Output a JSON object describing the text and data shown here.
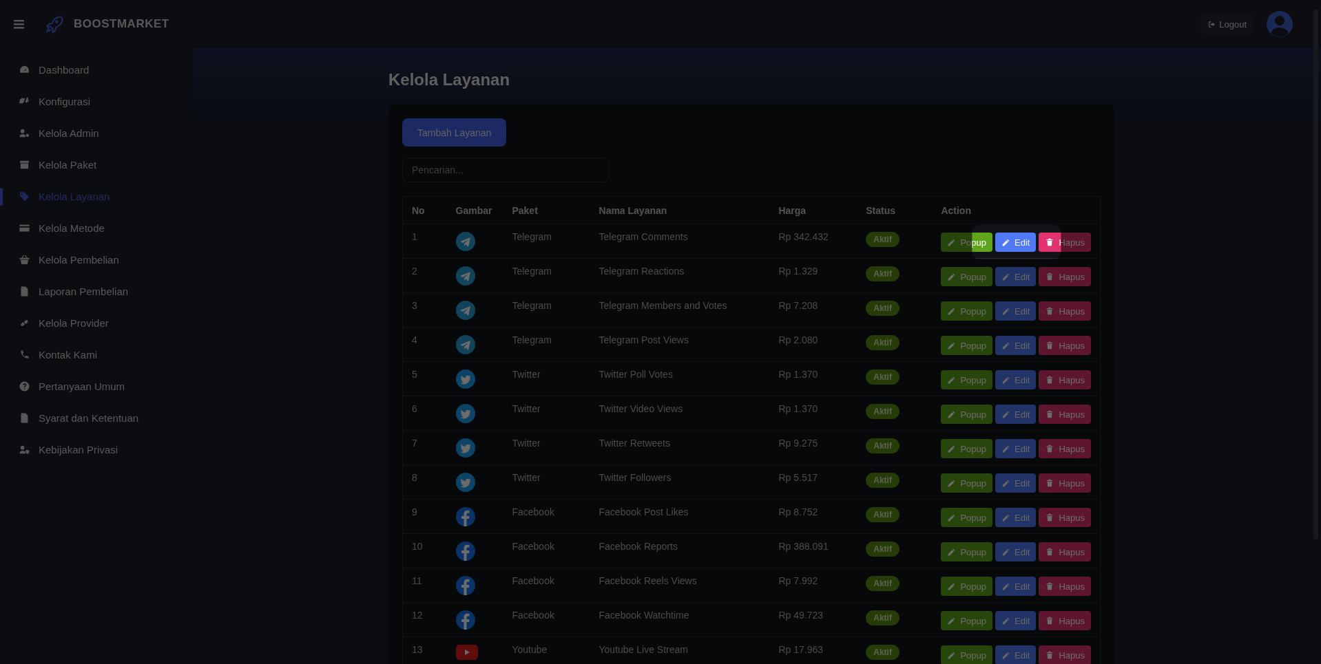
{
  "brand": {
    "name": "BOOSTMARKET"
  },
  "header": {
    "logout": "Logout"
  },
  "sidebar": {
    "items": [
      {
        "label": "Dashboard",
        "selected": false
      },
      {
        "label": "Konfigurasi",
        "selected": false
      },
      {
        "label": "Kelola Admin",
        "selected": false
      },
      {
        "label": "Kelola Paket",
        "selected": false
      },
      {
        "label": "Kelola Layanan",
        "selected": true
      },
      {
        "label": "Kelola Metode",
        "selected": false
      },
      {
        "label": "Kelola Pembelian",
        "selected": false
      },
      {
        "label": "Laporan Pembelian",
        "selected": false
      },
      {
        "label": "Kelola Provider",
        "selected": false
      },
      {
        "label": "Kontak Kami",
        "selected": false
      },
      {
        "label": "Pertanyaan Umum",
        "selected": false
      },
      {
        "label": "Syarat dan Ketentuan",
        "selected": false
      },
      {
        "label": "Kebijakan Privasi",
        "selected": false
      }
    ]
  },
  "page": {
    "title": "Kelola Layanan",
    "add_button": "Tambah Layanan",
    "search": {
      "placeholder": "Pencarian..."
    }
  },
  "table": {
    "columns": [
      "No",
      "Gambar",
      "Paket",
      "Nama Layanan",
      "Harga",
      "Status",
      "Action"
    ],
    "rows": [
      {
        "no": "1",
        "kind": "telegram",
        "paket": "Telegram",
        "name": "Telegram Comments",
        "price": "Rp 342.432",
        "status": "Aktif",
        "popup": "Popup",
        "edit": "Edit",
        "delete": "Hapus",
        "highlighted": true
      },
      {
        "no": "2",
        "kind": "telegram",
        "paket": "Telegram",
        "name": "Telegram Reactions",
        "price": "Rp 1.329",
        "status": "Aktif",
        "popup": "Popup",
        "edit": "Edit",
        "delete": "Hapus",
        "highlighted": false
      },
      {
        "no": "3",
        "kind": "telegram",
        "paket": "Telegram",
        "name": "Telegram Members and Votes",
        "price": "Rp 7.208",
        "status": "Aktif",
        "popup": "Popup",
        "edit": "Edit",
        "delete": "Hapus",
        "highlighted": false
      },
      {
        "no": "4",
        "kind": "telegram",
        "paket": "Telegram",
        "name": "Telegram Post Views",
        "price": "Rp 2.080",
        "status": "Aktif",
        "popup": "Popup",
        "edit": "Edit",
        "delete": "Hapus",
        "highlighted": false
      },
      {
        "no": "5",
        "kind": "twitter",
        "paket": "Twitter",
        "name": "Twitter Poll Votes",
        "price": "Rp 1.370",
        "status": "Aktif",
        "popup": "Popup",
        "edit": "Edit",
        "delete": "Hapus",
        "highlighted": false
      },
      {
        "no": "6",
        "kind": "twitter",
        "paket": "Twitter",
        "name": "Twitter Video Views",
        "price": "Rp 1.370",
        "status": "Aktif",
        "popup": "Popup",
        "edit": "Edit",
        "delete": "Hapus",
        "highlighted": false
      },
      {
        "no": "7",
        "kind": "twitter",
        "paket": "Twitter",
        "name": "Twitter Retweets",
        "price": "Rp 9.275",
        "status": "Aktif",
        "popup": "Popup",
        "edit": "Edit",
        "delete": "Hapus",
        "highlighted": false
      },
      {
        "no": "8",
        "kind": "twitter",
        "paket": "Twitter",
        "name": "Twitter Followers",
        "price": "Rp 5.517",
        "status": "Aktif",
        "popup": "Popup",
        "edit": "Edit",
        "delete": "Hapus",
        "highlighted": false
      },
      {
        "no": "9",
        "kind": "facebook",
        "paket": "Facebook",
        "name": "Facebook Post Likes",
        "price": "Rp 8.752",
        "status": "Aktif",
        "popup": "Popup",
        "edit": "Edit",
        "delete": "Hapus",
        "highlighted": false
      },
      {
        "no": "10",
        "kind": "facebook",
        "paket": "Facebook",
        "name": "Facebook Reports",
        "price": "Rp 388.091",
        "status": "Aktif",
        "popup": "Popup",
        "edit": "Edit",
        "delete": "Hapus",
        "highlighted": false
      },
      {
        "no": "11",
        "kind": "facebook",
        "paket": "Facebook",
        "name": "Facebook Reels Views",
        "price": "Rp 7.992",
        "status": "Aktif",
        "popup": "Popup",
        "edit": "Edit",
        "delete": "Hapus",
        "highlighted": false
      },
      {
        "no": "12",
        "kind": "facebook",
        "paket": "Facebook",
        "name": "Facebook Watchtime",
        "price": "Rp 49.723",
        "status": "Aktif",
        "popup": "Popup",
        "edit": "Edit",
        "delete": "Hapus",
        "highlighted": false
      },
      {
        "no": "13",
        "kind": "youtube",
        "paket": "Youtube",
        "name": "Youtube Live Stream",
        "price": "Rp 17.963",
        "status": "Aktif",
        "popup": "Popup",
        "edit": "Edit",
        "delete": "Hapus",
        "highlighted": false
      }
    ]
  }
}
